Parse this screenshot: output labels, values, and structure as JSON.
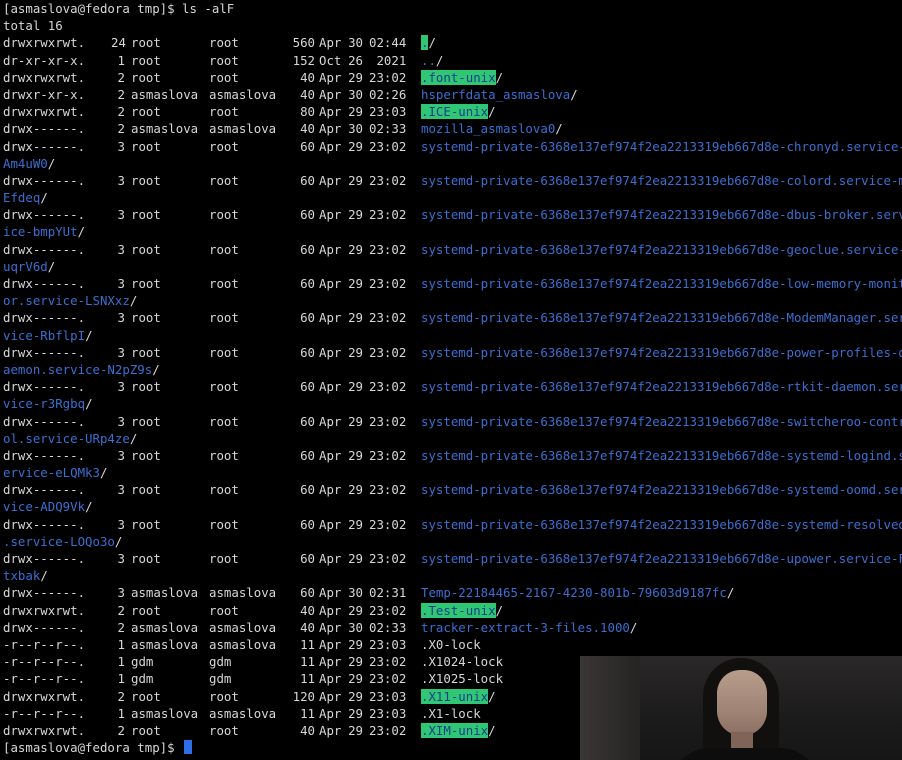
{
  "terminal": {
    "command_line": "[asmaslova@fedora tmp]$ ls -alF",
    "total_line": "total 16",
    "prompt": "[asmaslova@fedora tmp]$ ",
    "entries": [
      {
        "perm": "drwxrwxrwt.",
        "links": "24",
        "owner": "root",
        "group": "root",
        "size": "560",
        "month": "Apr",
        "day": "30",
        "time": "02:44",
        "name": ".",
        "suffix": "/",
        "style": "sticky"
      },
      {
        "perm": "dr-xr-xr-x.",
        "links": "1",
        "owner": "root",
        "group": "root",
        "size": "152",
        "month": "Oct",
        "day": "26",
        "time": " 2021",
        "name": "..",
        "suffix": "/",
        "style": "dir"
      },
      {
        "perm": "drwxrwxrwt.",
        "links": "2",
        "owner": "root",
        "group": "root",
        "size": "40",
        "month": "Apr",
        "day": "29",
        "time": "23:02",
        "name": ".font-unix",
        "suffix": "/",
        "style": "sticky"
      },
      {
        "perm": "drwxr-xr-x.",
        "links": "2",
        "owner": "asmaslova",
        "group": "asmaslova",
        "size": "40",
        "month": "Apr",
        "day": "30",
        "time": "02:26",
        "name": "hsperfdata_asmaslova",
        "suffix": "/",
        "style": "dir"
      },
      {
        "perm": "drwxrwxrwt.",
        "links": "2",
        "owner": "root",
        "group": "root",
        "size": "80",
        "month": "Apr",
        "day": "29",
        "time": "23:03",
        "name": ".ICE-unix",
        "suffix": "/",
        "style": "sticky"
      },
      {
        "perm": "drwx------.",
        "links": "2",
        "owner": "asmaslova",
        "group": "asmaslova",
        "size": "40",
        "month": "Apr",
        "day": "30",
        "time": "02:33",
        "name": "mozilla_asmaslova0",
        "suffix": "/",
        "style": "dir"
      },
      {
        "perm": "drwx------.",
        "links": "3",
        "owner": "root",
        "group": "root",
        "size": "60",
        "month": "Apr",
        "day": "29",
        "time": "23:02",
        "name": "systemd-private-6368e137ef974f2ea2213319eb667d8e-chronyd.service-",
        "name_cont": "Am4uW0",
        "suffix": "/",
        "style": "dir"
      },
      {
        "perm": "drwx------.",
        "links": "3",
        "owner": "root",
        "group": "root",
        "size": "60",
        "month": "Apr",
        "day": "29",
        "time": "23:02",
        "name": "systemd-private-6368e137ef974f2ea2213319eb667d8e-colord.service-m",
        "name_cont": "Efdeq",
        "suffix": "/",
        "style": "dir"
      },
      {
        "perm": "drwx------.",
        "links": "3",
        "owner": "root",
        "group": "root",
        "size": "60",
        "month": "Apr",
        "day": "29",
        "time": "23:02",
        "name": "systemd-private-6368e137ef974f2ea2213319eb667d8e-dbus-broker.serv",
        "name_cont": "ice-bmpYUt",
        "suffix": "/",
        "style": "dir"
      },
      {
        "perm": "drwx------.",
        "links": "3",
        "owner": "root",
        "group": "root",
        "size": "60",
        "month": "Apr",
        "day": "29",
        "time": "23:02",
        "name": "systemd-private-6368e137ef974f2ea2213319eb667d8e-geoclue.service-",
        "name_cont": "uqrV6d",
        "suffix": "/",
        "style": "dir"
      },
      {
        "perm": "drwx------.",
        "links": "3",
        "owner": "root",
        "group": "root",
        "size": "60",
        "month": "Apr",
        "day": "29",
        "time": "23:02",
        "name": "systemd-private-6368e137ef974f2ea2213319eb667d8e-low-memory-monit",
        "name_cont": "or.service-LSNXxz",
        "suffix": "/",
        "style": "dir"
      },
      {
        "perm": "drwx------.",
        "links": "3",
        "owner": "root",
        "group": "root",
        "size": "60",
        "month": "Apr",
        "day": "29",
        "time": "23:02",
        "name": "systemd-private-6368e137ef974f2ea2213319eb667d8e-ModemManager.ser",
        "name_cont": "vice-RbflpI",
        "suffix": "/",
        "style": "dir"
      },
      {
        "perm": "drwx------.",
        "links": "3",
        "owner": "root",
        "group": "root",
        "size": "60",
        "month": "Apr",
        "day": "29",
        "time": "23:02",
        "name": "systemd-private-6368e137ef974f2ea2213319eb667d8e-power-profiles-d",
        "name_cont": "aemon.service-N2pZ9s",
        "suffix": "/",
        "style": "dir"
      },
      {
        "perm": "drwx------.",
        "links": "3",
        "owner": "root",
        "group": "root",
        "size": "60",
        "month": "Apr",
        "day": "29",
        "time": "23:02",
        "name": "systemd-private-6368e137ef974f2ea2213319eb667d8e-rtkit-daemon.ser",
        "name_cont": "vice-r3Rgbq",
        "suffix": "/",
        "style": "dir"
      },
      {
        "perm": "drwx------.",
        "links": "3",
        "owner": "root",
        "group": "root",
        "size": "60",
        "month": "Apr",
        "day": "29",
        "time": "23:02",
        "name": "systemd-private-6368e137ef974f2ea2213319eb667d8e-switcheroo-contr",
        "name_cont": "ol.service-URp4ze",
        "suffix": "/",
        "style": "dir"
      },
      {
        "perm": "drwx------.",
        "links": "3",
        "owner": "root",
        "group": "root",
        "size": "60",
        "month": "Apr",
        "day": "29",
        "time": "23:02",
        "name": "systemd-private-6368e137ef974f2ea2213319eb667d8e-systemd-logind.s",
        "name_cont": "ervice-eLQMk3",
        "suffix": "/",
        "style": "dir"
      },
      {
        "perm": "drwx------.",
        "links": "3",
        "owner": "root",
        "group": "root",
        "size": "60",
        "month": "Apr",
        "day": "29",
        "time": "23:02",
        "name": "systemd-private-6368e137ef974f2ea2213319eb667d8e-systemd-oomd.ser",
        "name_cont": "vice-ADQ9Vk",
        "suffix": "/",
        "style": "dir"
      },
      {
        "perm": "drwx------.",
        "links": "3",
        "owner": "root",
        "group": "root",
        "size": "60",
        "month": "Apr",
        "day": "29",
        "time": "23:02",
        "name": "systemd-private-6368e137ef974f2ea2213319eb667d8e-systemd-resolved",
        "name_cont": ".service-LOQo3o",
        "suffix": "/",
        "style": "dir"
      },
      {
        "perm": "drwx------.",
        "links": "3",
        "owner": "root",
        "group": "root",
        "size": "60",
        "month": "Apr",
        "day": "29",
        "time": "23:02",
        "name": "systemd-private-6368e137ef974f2ea2213319eb667d8e-upower.service-F",
        "name_cont": "txbak",
        "suffix": "/",
        "style": "dir"
      },
      {
        "perm": "drwx------.",
        "links": "3",
        "owner": "asmaslova",
        "group": "asmaslova",
        "size": "60",
        "month": "Apr",
        "day": "30",
        "time": "02:31",
        "name": "Temp-22184465-2167-4230-801b-79603d9187fc",
        "suffix": "/",
        "style": "dir"
      },
      {
        "perm": "drwxrwxrwt.",
        "links": "2",
        "owner": "root",
        "group": "root",
        "size": "40",
        "month": "Apr",
        "day": "29",
        "time": "23:02",
        "name": ".Test-unix",
        "suffix": "/",
        "style": "sticky"
      },
      {
        "perm": "drwx------.",
        "links": "2",
        "owner": "asmaslova",
        "group": "asmaslova",
        "size": "40",
        "month": "Apr",
        "day": "30",
        "time": "02:33",
        "name": "tracker-extract-3-files.1000",
        "suffix": "/",
        "style": "dir"
      },
      {
        "perm": "-r--r--r--.",
        "links": "1",
        "owner": "asmaslova",
        "group": "asmaslova",
        "size": "11",
        "month": "Apr",
        "day": "29",
        "time": "23:03",
        "name": ".X0-lock",
        "suffix": "",
        "style": "file"
      },
      {
        "perm": "-r--r--r--.",
        "links": "1",
        "owner": "gdm",
        "group": "gdm",
        "size": "11",
        "month": "Apr",
        "day": "29",
        "time": "23:02",
        "name": ".X1024-lock",
        "suffix": "",
        "style": "file"
      },
      {
        "perm": "-r--r--r--.",
        "links": "1",
        "owner": "gdm",
        "group": "gdm",
        "size": "11",
        "month": "Apr",
        "day": "29",
        "time": "23:02",
        "name": ".X1025-lock",
        "suffix": "",
        "style": "file"
      },
      {
        "perm": "drwxrwxrwt.",
        "links": "2",
        "owner": "root",
        "group": "root",
        "size": "120",
        "month": "Apr",
        "day": "29",
        "time": "23:03",
        "name": ".X11-unix",
        "suffix": "/",
        "style": "sticky"
      },
      {
        "perm": "-r--r--r--.",
        "links": "1",
        "owner": "asmaslova",
        "group": "asmaslova",
        "size": "11",
        "month": "Apr",
        "day": "29",
        "time": "23:03",
        "name": ".X1-lock",
        "suffix": "",
        "style": "file"
      },
      {
        "perm": "drwxrwxrwt.",
        "links": "2",
        "owner": "root",
        "group": "root",
        "size": "40",
        "month": "Apr",
        "day": "29",
        "time": "23:02",
        "name": ".XIM-unix",
        "suffix": "/",
        "style": "sticky"
      }
    ]
  },
  "colors": {
    "background": "#000000",
    "text": "#d7d7d7",
    "directory": "#3b6fd1",
    "sticky_bg": "#2fc774",
    "sticky_fg": "#1b3d8d",
    "cursor": "#2e6ee8"
  },
  "webcam": {
    "icon": "webcam-overlay"
  }
}
